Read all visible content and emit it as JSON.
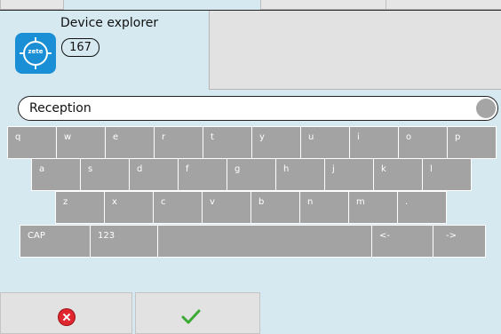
{
  "header": {
    "app_name": "Device explorer",
    "device_count": "167",
    "logo_text": "zete"
  },
  "search": {
    "value": "Reception"
  },
  "keyboard": {
    "row1": [
      "q",
      "w",
      "e",
      "r",
      "t",
      "y",
      "u",
      "i",
      "o",
      "p"
    ],
    "row2": [
      "a",
      "s",
      "d",
      "f",
      "g",
      "h",
      "j",
      "k",
      "l"
    ],
    "row3": [
      "z",
      "x",
      "c",
      "v",
      "b",
      "n",
      "m",
      "."
    ],
    "row4": [
      "CAP",
      "123",
      "",
      "<-",
      "->"
    ]
  },
  "icons": {
    "app": "device-explorer-icon",
    "cancel": "cancel-icon",
    "confirm": "checkmark-icon"
  },
  "colors": {
    "background": "#d6e9f1",
    "key": "#a3a3a3",
    "brand": "#1a8fd6",
    "cancel": "#e0262e",
    "confirm": "#3aaa35"
  }
}
